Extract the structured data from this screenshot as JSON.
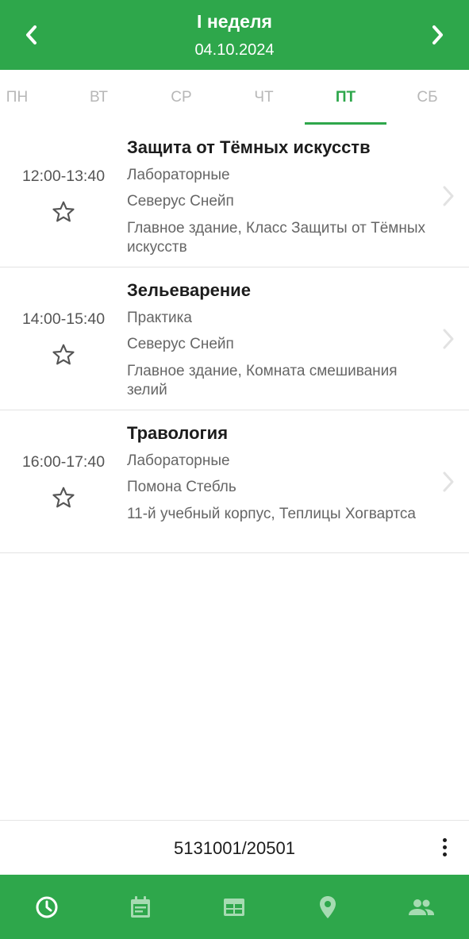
{
  "header": {
    "week": "I неделя",
    "date": "04.10.2024",
    "prev_icon": "chevron-left-icon",
    "next_icon": "chevron-right-icon"
  },
  "tabs": [
    {
      "label": "ПН",
      "active": false
    },
    {
      "label": "ВТ",
      "active": false
    },
    {
      "label": "СР",
      "active": false
    },
    {
      "label": "ЧТ",
      "active": false
    },
    {
      "label": "ПТ",
      "active": true
    },
    {
      "label": "СБ",
      "active": false
    }
  ],
  "lessons": [
    {
      "time": "12:00-13:40",
      "title": "Защита от Тёмных искусств",
      "type": "Лабораторные",
      "teacher": "Северус Снейп",
      "place": "Главное здание, Класс Защиты от Тёмных искусств"
    },
    {
      "time": "14:00-15:40",
      "title": "Зельеварение",
      "type": "Практика",
      "teacher": "Северус Снейп",
      "place": "Главное здание, Комната смешивания зелий"
    },
    {
      "time": "16:00-17:40",
      "title": "Травология",
      "type": "Лабораторные",
      "teacher": "Помона Стебль",
      "place": "11-й учебный корпус, Теплицы Хогвартса"
    }
  ],
  "footer": {
    "group_id": "5131001/20501",
    "menu_icon": "more-vertical-icon"
  },
  "bottom_nav": [
    {
      "icon": "clock-icon",
      "active": true
    },
    {
      "icon": "calendar-icon",
      "active": false
    },
    {
      "icon": "table-icon",
      "active": false
    },
    {
      "icon": "map-pin-icon",
      "active": false
    },
    {
      "icon": "people-icon",
      "active": false
    }
  ],
  "colors": {
    "accent": "#2ea74b",
    "nav_inactive": "#a6dbb2"
  }
}
